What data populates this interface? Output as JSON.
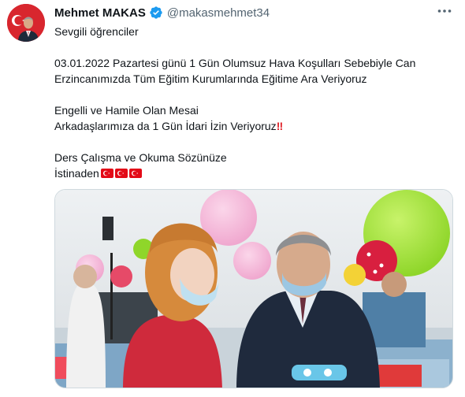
{
  "tweet": {
    "author": {
      "display_name": "Mehmet MAKAS",
      "handle": "@makasmehmet34",
      "verified": true
    },
    "lines": [
      "Sevgili öğrenciler",
      "",
      "03.01.2022 Pazartesi günü 1 Gün Olumsuz Hava Koşulları Sebebiyle  Can",
      "Erzincanımızda Tüm Eğitim Kurumlarında Eğitime Ara Veriyoruz",
      "",
      "Engelli ve Hamile Olan Mesai",
      "Arkadaşlarımıza da 1 Gün İdari İzin Veriyoruz",
      "",
      "Ders Çalışma ve Okuma Sözünüze",
      "İstinaden"
    ],
    "double_exclamation": "‼",
    "flag_count": 3
  },
  "icons": {
    "verified": "verified-badge-icon",
    "more": "more-options-icon",
    "flag": "turkey-flag-icon"
  },
  "colors": {
    "verified_blue": "#1d9bf0",
    "handle_gray": "#536471",
    "text": "#0f1419",
    "flag_red": "#e30a17",
    "avatar_red": "#d8262e"
  }
}
